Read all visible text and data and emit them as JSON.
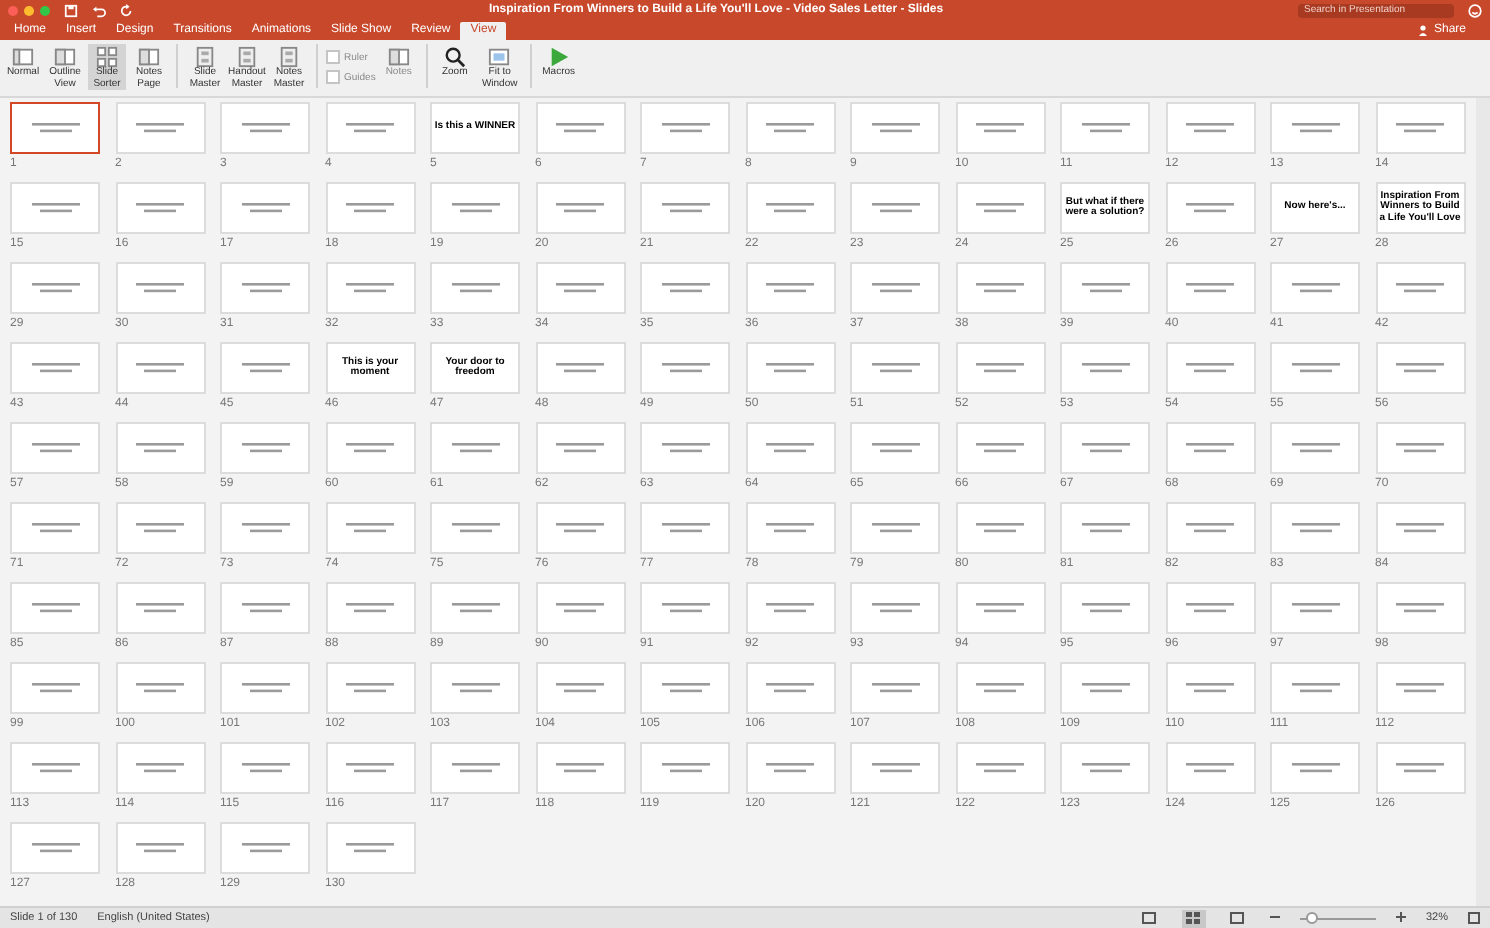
{
  "window": {
    "title": "Inspiration From Winners to Build a Life You'll Love - Video Sales Letter - Slides"
  },
  "search": {
    "placeholder": "Search in Presentation"
  },
  "tabs": [
    {
      "label": "Home",
      "selected": false
    },
    {
      "label": "Insert",
      "selected": false
    },
    {
      "label": "Design",
      "selected": false
    },
    {
      "label": "Transitions",
      "selected": false
    },
    {
      "label": "Animations",
      "selected": false
    },
    {
      "label": "Slide Show",
      "selected": false
    },
    {
      "label": "Review",
      "selected": false
    },
    {
      "label": "View",
      "selected": true
    }
  ],
  "share": "Share",
  "ribbon": [
    {
      "kind": "view",
      "label": "Normal",
      "selected": false,
      "disabled": false
    },
    {
      "kind": "view",
      "label": "Outline View",
      "selected": false,
      "disabled": false
    },
    {
      "kind": "sorter",
      "label": "Slide Sorter",
      "selected": true,
      "disabled": false
    },
    {
      "kind": "view",
      "label": "Notes Page",
      "selected": false,
      "disabled": false
    },
    {
      "kind": "divider"
    },
    {
      "kind": "master",
      "label": "Slide Master",
      "selected": false,
      "disabled": false
    },
    {
      "kind": "master",
      "label": "Handout Master",
      "selected": false,
      "disabled": false
    },
    {
      "kind": "master",
      "label": "Notes Master",
      "selected": false,
      "disabled": false
    },
    {
      "kind": "divider"
    },
    {
      "kind": "checks",
      "items": [
        {
          "label": "Ruler",
          "checked": false,
          "disabled": true
        },
        {
          "label": "Guides",
          "checked": false,
          "disabled": true
        }
      ]
    },
    {
      "kind": "view",
      "label": "Notes",
      "selected": false,
      "disabled": true
    },
    {
      "kind": "divider"
    },
    {
      "kind": "zoom",
      "label": "Zoom",
      "selected": false,
      "disabled": false
    },
    {
      "kind": "fit",
      "label": "Fit to Window",
      "selected": false,
      "disabled": false
    },
    {
      "kind": "divider"
    },
    {
      "kind": "play",
      "label": "Macros",
      "selected": false,
      "disabled": false
    }
  ],
  "slides": [
    {
      "number": "1",
      "selected": true,
      "kind": "lines"
    },
    {
      "number": "2",
      "selected": false,
      "kind": "lines"
    },
    {
      "number": "3",
      "selected": false,
      "kind": "lines"
    },
    {
      "number": "4",
      "selected": false,
      "kind": "lines"
    },
    {
      "number": "5",
      "selected": false,
      "kind": "title",
      "text": "Is this a WINNER"
    },
    {
      "number": "6",
      "selected": false,
      "kind": "lines"
    },
    {
      "number": "7",
      "selected": false,
      "kind": "lines"
    },
    {
      "number": "8",
      "selected": false,
      "kind": "lines"
    },
    {
      "number": "9",
      "selected": false,
      "kind": "lines"
    },
    {
      "number": "10",
      "selected": false,
      "kind": "lines"
    },
    {
      "number": "11",
      "selected": false,
      "kind": "lines"
    },
    {
      "number": "12",
      "selected": false,
      "kind": "lines"
    },
    {
      "number": "13",
      "selected": false,
      "kind": "lines"
    },
    {
      "number": "14",
      "selected": false,
      "kind": "lines"
    },
    {
      "number": "15",
      "selected": false,
      "kind": "lines"
    },
    {
      "number": "16",
      "selected": false,
      "kind": "lines"
    },
    {
      "number": "17",
      "selected": false,
      "kind": "lines"
    },
    {
      "number": "18",
      "selected": false,
      "kind": "lines"
    },
    {
      "number": "19",
      "selected": false,
      "kind": "lines"
    },
    {
      "number": "20",
      "selected": false,
      "kind": "lines"
    },
    {
      "number": "21",
      "selected": false,
      "kind": "lines"
    },
    {
      "number": "22",
      "selected": false,
      "kind": "lines"
    },
    {
      "number": "23",
      "selected": false,
      "kind": "lines"
    },
    {
      "number": "24",
      "selected": false,
      "kind": "lines"
    },
    {
      "number": "25",
      "selected": false,
      "kind": "title",
      "text": "But what if there were a solution?"
    },
    {
      "number": "26",
      "selected": false,
      "kind": "lines"
    },
    {
      "number": "27",
      "selected": false,
      "kind": "title",
      "text": "Now here's..."
    },
    {
      "number": "28",
      "selected": false,
      "kind": "title",
      "text": "Inspiration From Winners to Build a Life You'll Love"
    },
    {
      "number": "29",
      "selected": false,
      "kind": "lines"
    },
    {
      "number": "30",
      "selected": false,
      "kind": "lines"
    },
    {
      "number": "31",
      "selected": false,
      "kind": "lines"
    },
    {
      "number": "32",
      "selected": false,
      "kind": "lines"
    },
    {
      "number": "33",
      "selected": false,
      "kind": "lines"
    },
    {
      "number": "34",
      "selected": false,
      "kind": "lines"
    },
    {
      "number": "35",
      "selected": false,
      "kind": "lines"
    },
    {
      "number": "36",
      "selected": false,
      "kind": "lines"
    },
    {
      "number": "37",
      "selected": false,
      "kind": "lines"
    },
    {
      "number": "38",
      "selected": false,
      "kind": "lines"
    },
    {
      "number": "39",
      "selected": false,
      "kind": "lines"
    },
    {
      "number": "40",
      "selected": false,
      "kind": "lines"
    },
    {
      "number": "41",
      "selected": false,
      "kind": "lines"
    },
    {
      "number": "42",
      "selected": false,
      "kind": "lines"
    },
    {
      "number": "43",
      "selected": false,
      "kind": "lines"
    },
    {
      "number": "44",
      "selected": false,
      "kind": "lines"
    },
    {
      "number": "45",
      "selected": false,
      "kind": "lines"
    },
    {
      "number": "46",
      "selected": false,
      "kind": "title",
      "text": "This is your moment"
    },
    {
      "number": "47",
      "selected": false,
      "kind": "title",
      "text": "Your door to freedom"
    },
    {
      "number": "48",
      "selected": false,
      "kind": "lines"
    },
    {
      "number": "49",
      "selected": false,
      "kind": "lines"
    },
    {
      "number": "50",
      "selected": false,
      "kind": "lines"
    },
    {
      "number": "51",
      "selected": false,
      "kind": "lines"
    },
    {
      "number": "52",
      "selected": false,
      "kind": "lines"
    },
    {
      "number": "53",
      "selected": false,
      "kind": "lines"
    },
    {
      "number": "54",
      "selected": false,
      "kind": "lines"
    },
    {
      "number": "55",
      "selected": false,
      "kind": "lines"
    },
    {
      "number": "56",
      "selected": false,
      "kind": "lines"
    },
    {
      "number": "57",
      "selected": false,
      "kind": "lines"
    },
    {
      "number": "58",
      "selected": false,
      "kind": "lines"
    },
    {
      "number": "59",
      "selected": false,
      "kind": "lines"
    },
    {
      "number": "60",
      "selected": false,
      "kind": "lines"
    },
    {
      "number": "61",
      "selected": false,
      "kind": "lines"
    },
    {
      "number": "62",
      "selected": false,
      "kind": "lines"
    },
    {
      "number": "63",
      "selected": false,
      "kind": "lines"
    },
    {
      "number": "64",
      "selected": false,
      "kind": "lines"
    },
    {
      "number": "65",
      "selected": false,
      "kind": "lines"
    },
    {
      "number": "66",
      "selected": false,
      "kind": "lines"
    },
    {
      "number": "67",
      "selected": false,
      "kind": "lines"
    },
    {
      "number": "68",
      "selected": false,
      "kind": "lines"
    },
    {
      "number": "69",
      "selected": false,
      "kind": "lines"
    },
    {
      "number": "70",
      "selected": false,
      "kind": "lines"
    },
    {
      "number": "71",
      "selected": false,
      "kind": "lines"
    },
    {
      "number": "72",
      "selected": false,
      "kind": "lines"
    },
    {
      "number": "73",
      "selected": false,
      "kind": "lines"
    },
    {
      "number": "74",
      "selected": false,
      "kind": "lines"
    },
    {
      "number": "75",
      "selected": false,
      "kind": "lines"
    },
    {
      "number": "76",
      "selected": false,
      "kind": "lines"
    },
    {
      "number": "77",
      "selected": false,
      "kind": "lines"
    },
    {
      "number": "78",
      "selected": false,
      "kind": "lines"
    },
    {
      "number": "79",
      "selected": false,
      "kind": "lines"
    },
    {
      "number": "80",
      "selected": false,
      "kind": "lines"
    },
    {
      "number": "81",
      "selected": false,
      "kind": "lines"
    },
    {
      "number": "82",
      "selected": false,
      "kind": "lines"
    },
    {
      "number": "83",
      "selected": false,
      "kind": "lines"
    },
    {
      "number": "84",
      "selected": false,
      "kind": "lines"
    },
    {
      "number": "85",
      "selected": false,
      "kind": "lines"
    },
    {
      "number": "86",
      "selected": false,
      "kind": "lines"
    },
    {
      "number": "87",
      "selected": false,
      "kind": "lines"
    },
    {
      "number": "88",
      "selected": false,
      "kind": "lines"
    },
    {
      "number": "89",
      "selected": false,
      "kind": "lines"
    },
    {
      "number": "90",
      "selected": false,
      "kind": "lines"
    },
    {
      "number": "91",
      "selected": false,
      "kind": "lines"
    },
    {
      "number": "92",
      "selected": false,
      "kind": "lines"
    },
    {
      "number": "93",
      "selected": false,
      "kind": "lines"
    },
    {
      "number": "94",
      "selected": false,
      "kind": "lines"
    },
    {
      "number": "95",
      "selected": false,
      "kind": "lines"
    },
    {
      "number": "96",
      "selected": false,
      "kind": "lines"
    },
    {
      "number": "97",
      "selected": false,
      "kind": "lines"
    },
    {
      "number": "98",
      "selected": false,
      "kind": "lines"
    },
    {
      "number": "99",
      "selected": false,
      "kind": "lines"
    },
    {
      "number": "100",
      "selected": false,
      "kind": "lines"
    },
    {
      "number": "101",
      "selected": false,
      "kind": "lines"
    },
    {
      "number": "102",
      "selected": false,
      "kind": "lines"
    },
    {
      "number": "103",
      "selected": false,
      "kind": "lines"
    },
    {
      "number": "104",
      "selected": false,
      "kind": "lines"
    },
    {
      "number": "105",
      "selected": false,
      "kind": "lines"
    },
    {
      "number": "106",
      "selected": false,
      "kind": "lines"
    },
    {
      "number": "107",
      "selected": false,
      "kind": "lines"
    },
    {
      "number": "108",
      "selected": false,
      "kind": "lines"
    },
    {
      "number": "109",
      "selected": false,
      "kind": "lines"
    },
    {
      "number": "110",
      "selected": false,
      "kind": "lines"
    },
    {
      "number": "111",
      "selected": false,
      "kind": "lines"
    },
    {
      "number": "112",
      "selected": false,
      "kind": "lines"
    },
    {
      "number": "113",
      "selected": false,
      "kind": "lines"
    },
    {
      "number": "114",
      "selected": false,
      "kind": "lines"
    },
    {
      "number": "115",
      "selected": false,
      "kind": "lines"
    },
    {
      "number": "116",
      "selected": false,
      "kind": "lines"
    },
    {
      "number": "117",
      "selected": false,
      "kind": "lines"
    },
    {
      "number": "118",
      "selected": false,
      "kind": "lines"
    },
    {
      "number": "119",
      "selected": false,
      "kind": "lines"
    },
    {
      "number": "120",
      "selected": false,
      "kind": "lines"
    },
    {
      "number": "121",
      "selected": false,
      "kind": "lines"
    },
    {
      "number": "122",
      "selected": false,
      "kind": "lines"
    },
    {
      "number": "123",
      "selected": false,
      "kind": "lines"
    },
    {
      "number": "124",
      "selected": false,
      "kind": "lines"
    },
    {
      "number": "125",
      "selected": false,
      "kind": "lines"
    },
    {
      "number": "126",
      "selected": false,
      "kind": "lines"
    },
    {
      "number": "127",
      "selected": false,
      "kind": "lines"
    },
    {
      "number": "128",
      "selected": false,
      "kind": "lines"
    },
    {
      "number": "129",
      "selected": false,
      "kind": "lines"
    },
    {
      "number": "130",
      "selected": false,
      "kind": "lines"
    }
  ],
  "status_bar": {
    "slide_info": "Slide 1 of 130",
    "language": "English (United States)",
    "views": [
      {
        "selected": false
      },
      {
        "selected": true
      },
      {
        "selected": false
      }
    ],
    "zoom": {
      "level": 0.15,
      "reading": "32%"
    }
  }
}
